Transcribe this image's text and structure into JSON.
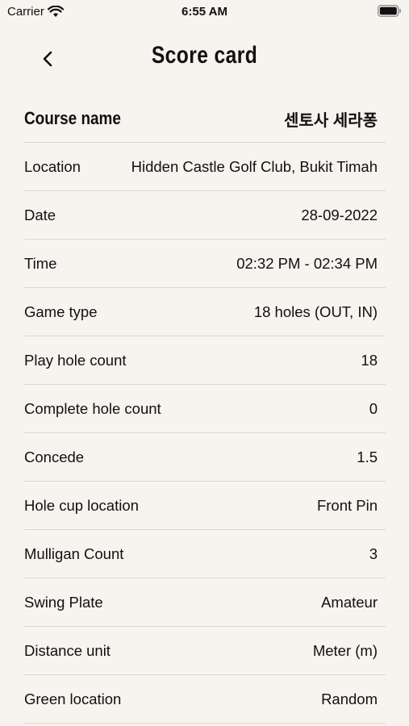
{
  "status_bar": {
    "carrier": "Carrier",
    "time": "6:55 AM"
  },
  "nav": {
    "title": "Score card",
    "back_icon": "chevron-left-icon"
  },
  "course": {
    "label": "Course name",
    "value": "센토사 세라퐁"
  },
  "rows": [
    {
      "label": "Location",
      "value": "Hidden Castle Golf Club, Bukit Timah"
    },
    {
      "label": "Date",
      "value": "28-09-2022"
    },
    {
      "label": "Time",
      "value": "02:32 PM - 02:34 PM"
    },
    {
      "label": "Game type",
      "value": "18 holes (OUT, IN)"
    },
    {
      "label": "Play hole count",
      "value": "18"
    },
    {
      "label": "Complete hole count",
      "value": "0"
    },
    {
      "label": "Concede",
      "value": "1.5"
    },
    {
      "label": "Hole cup location",
      "value": "Front Pin"
    },
    {
      "label": "Mulligan Count",
      "value": "3"
    },
    {
      "label": "Swing Plate",
      "value": "Amateur"
    },
    {
      "label": "Distance unit",
      "value": "Meter (m)"
    },
    {
      "label": "Green location",
      "value": "Random"
    }
  ],
  "colors": {
    "background": "#f7f3ee",
    "divider": "#ddd7d0",
    "text": "#111111"
  }
}
